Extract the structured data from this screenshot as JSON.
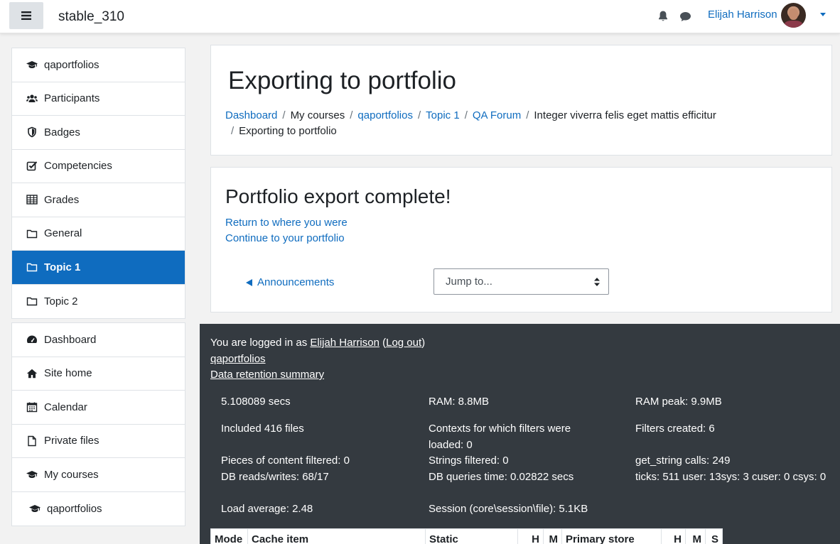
{
  "navbar": {
    "site_name": "stable_310",
    "user_name": "Elijah Harrison"
  },
  "sidebar": {
    "course_nav": [
      {
        "icon": "graduation-cap-icon",
        "label": "qaportfolios"
      },
      {
        "icon": "users-icon",
        "label": "Participants"
      },
      {
        "icon": "shield-icon",
        "label": "Badges"
      },
      {
        "icon": "check-square-icon",
        "label": "Competencies"
      },
      {
        "icon": "table-icon",
        "label": "Grades"
      },
      {
        "icon": "folder-icon",
        "label": "General"
      },
      {
        "icon": "folder-icon",
        "label": "Topic 1",
        "active": true
      },
      {
        "icon": "folder-icon",
        "label": "Topic 2"
      }
    ],
    "site_nav": [
      {
        "icon": "dashboard-icon",
        "label": "Dashboard"
      },
      {
        "icon": "home-icon",
        "label": "Site home"
      },
      {
        "icon": "calendar-icon",
        "label": "Calendar"
      },
      {
        "icon": "file-icon",
        "label": "Private files"
      },
      {
        "icon": "graduation-cap-icon",
        "label": "My courses"
      },
      {
        "icon": "graduation-cap-icon",
        "label": "qaportfolios"
      }
    ]
  },
  "header": {
    "title": "Exporting to portfolio",
    "breadcrumb": {
      "dashboard": "Dashboard",
      "my_courses": "My courses",
      "course": "qaportfolios",
      "topic": "Topic 1",
      "forum": "QA Forum",
      "discussion": "Integer viverra felis eget mattis efficitur",
      "current": "Exporting to portfolio",
      "separator": "/"
    }
  },
  "main": {
    "heading": "Portfolio export complete!",
    "return_link": "Return to where you were",
    "continue_link": "Continue to your portfolio",
    "prev_activity": "Announcements",
    "jump_to": "Jump to..."
  },
  "footer": {
    "logged_in_prefix": "You are logged in as ",
    "user_name": "Elijah Harrison",
    "logout_open": " (",
    "logout": "Log out",
    "logout_close": ")",
    "course_link": "qaportfolios",
    "data_retention": "Data retention summary",
    "perf": {
      "time": "5.108089 secs",
      "ram": "RAM: 8.8MB",
      "ram_peak": "RAM peak: 9.9MB",
      "included_files": "Included 416 files",
      "contexts": "Contexts for which filters were loaded: 0",
      "filters_created": "Filters created: 6",
      "pieces_filtered": "Pieces of content filtered: 0",
      "strings_filtered": "Strings filtered: 0",
      "get_string": "get_string calls: 249",
      "db_rw": "DB reads/writes: 68/17",
      "db_time": "DB queries time: 0.02822 secs",
      "ticks": "ticks: 511 user: 13sys: 3 cuser: 0 csys: 0",
      "load_avg": "Load average: 2.48",
      "session": "Session (core\\session\\file): 5.1KB"
    },
    "cache_headers": [
      "Mode",
      "Cache item",
      "Static",
      "H",
      "M",
      "Primary store",
      "H",
      "M",
      "S"
    ]
  }
}
